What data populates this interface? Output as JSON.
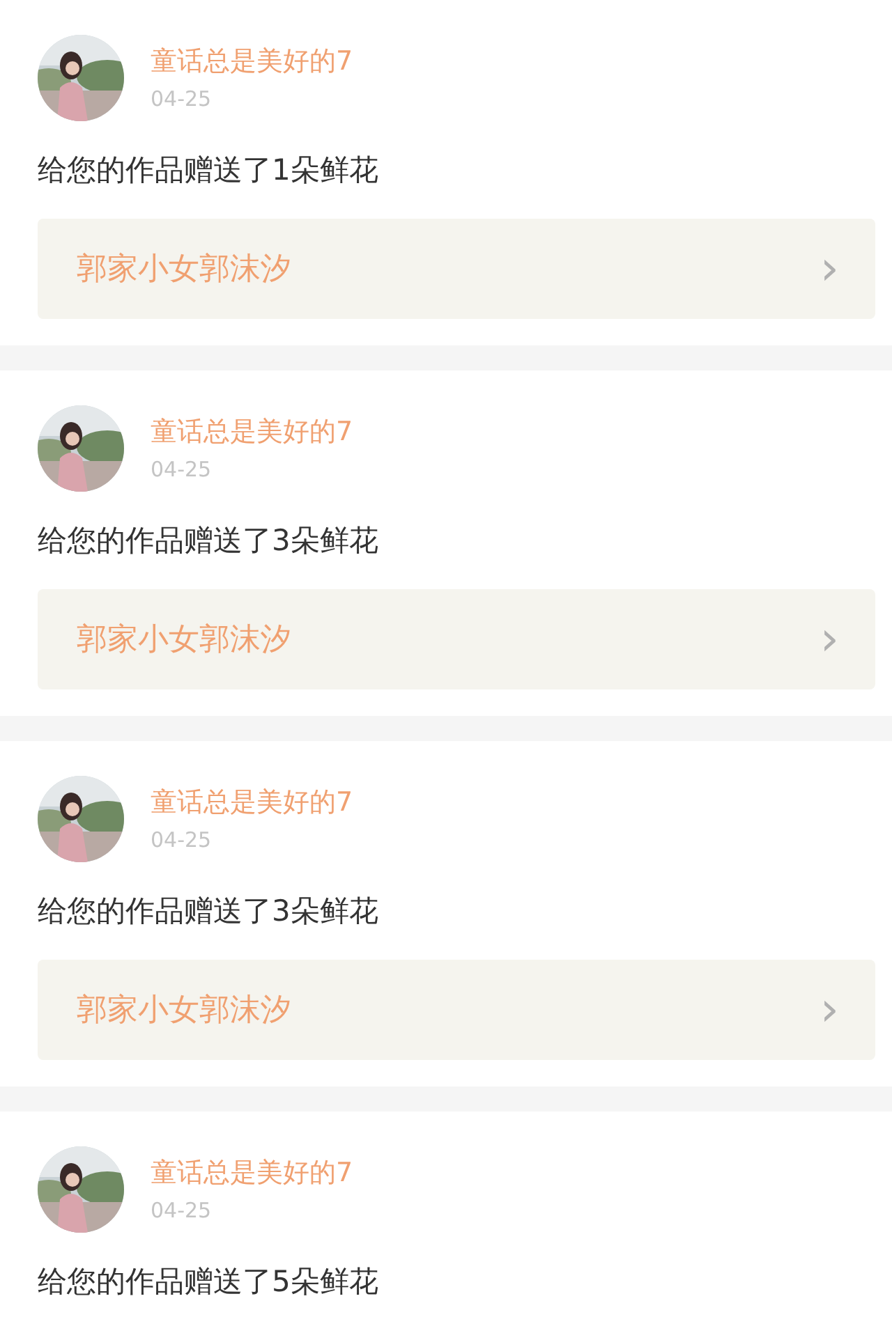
{
  "notifications": [
    {
      "user": "童话总是美好的7",
      "date": "04-25",
      "message": "给您的作品赠送了1朵鲜花",
      "work": {
        "title": "郭家小女郭沫汐",
        "chevron": "›"
      }
    },
    {
      "user": "童话总是美好的7",
      "date": "04-25",
      "message": "给您的作品赠送了3朵鲜花",
      "work": {
        "title": "郭家小女郭沫汐",
        "chevron": "›"
      }
    },
    {
      "user": "童话总是美好的7",
      "date": "04-25",
      "message": "给您的作品赠送了3朵鲜花",
      "work": {
        "title": "郭家小女郭沫汐",
        "chevron": "›"
      }
    },
    {
      "user": "童话总是美好的7",
      "date": "04-25",
      "message": "给您的作品赠送了5朵鲜花"
    }
  ]
}
